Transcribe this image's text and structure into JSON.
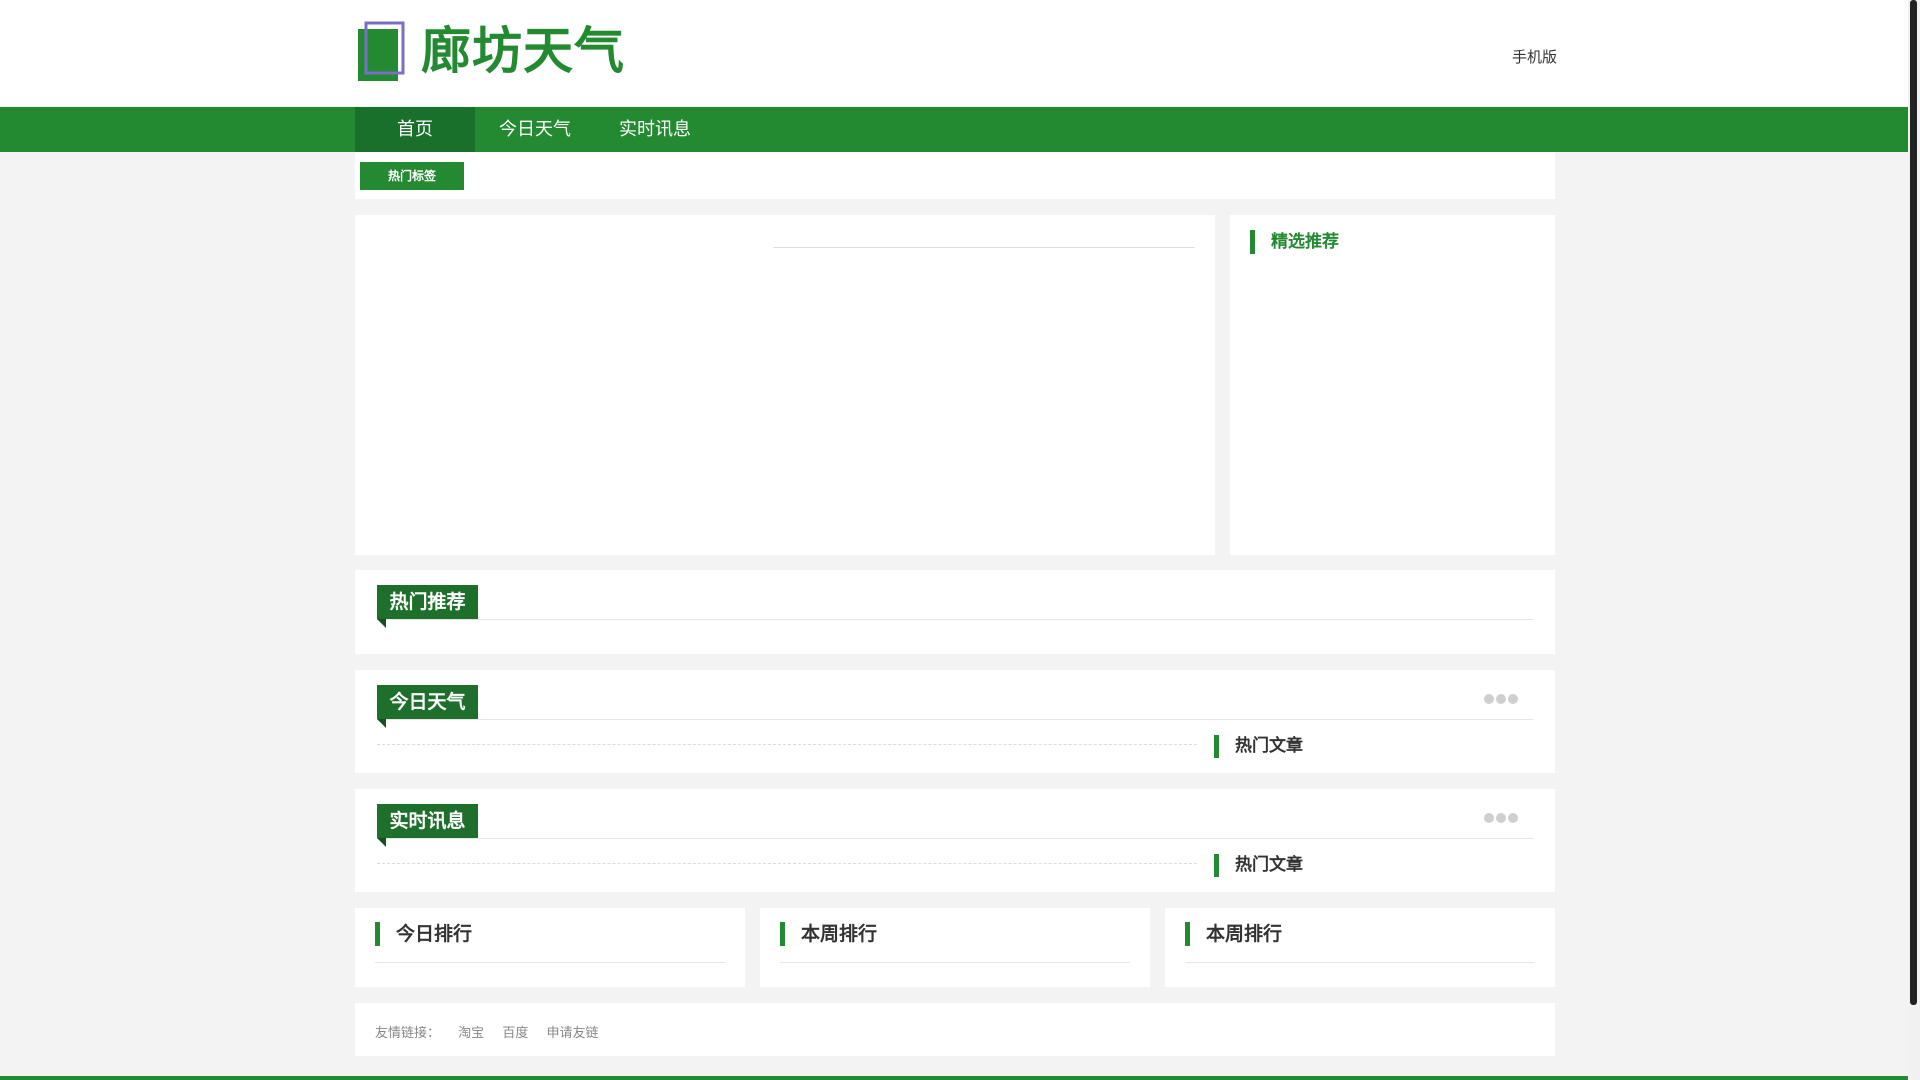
{
  "header": {
    "site_name": "廊坊天气",
    "mobile_link": "手机版"
  },
  "nav": {
    "items": [
      {
        "label": "首页",
        "active": true
      },
      {
        "label": "今日天气",
        "active": false
      },
      {
        "label": "实时讯息",
        "active": false
      }
    ]
  },
  "tags": {
    "badge": "热门标签"
  },
  "featured": {
    "title": "精选推荐"
  },
  "sections": {
    "hot": {
      "title": "热门推荐"
    },
    "today": {
      "title": "今日天气",
      "side_title": "热门文章"
    },
    "live": {
      "title": "实时讯息",
      "side_title": "热门文章"
    }
  },
  "ranking": [
    {
      "title": "今日排行"
    },
    {
      "title": "本周排行"
    },
    {
      "title": "本周排行"
    }
  ],
  "friend_links": {
    "label": "友情链接：",
    "links": [
      "淘宝",
      "百度",
      "申请友链"
    ]
  },
  "colors": {
    "brand_green": "#238a32",
    "dark_green": "#19702a",
    "logo_outline": "#7b6fc4"
  }
}
